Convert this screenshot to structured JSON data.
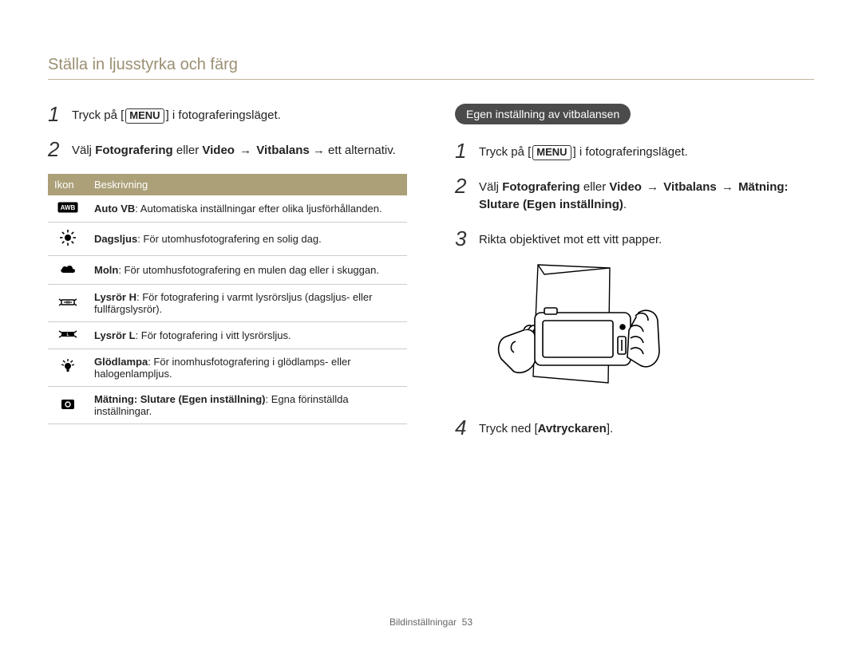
{
  "breadcrumb": "Ställa in ljusstyrka och färg",
  "left": {
    "step1_prefix": "Tryck på [",
    "step1_btn": "MENU",
    "step1_suffix": "] i fotograferingsläget.",
    "step2_a": "Välj ",
    "step2_b": "Fotografering",
    "step2_c": " eller ",
    "step2_d": "Video",
    "step2_e": " → ",
    "step2_f": "Vitbalans",
    "step2_g": " → ett alternativ."
  },
  "table": {
    "h1": "Ikon",
    "h2": "Beskrivning",
    "rows": [
      {
        "label": "Auto VB",
        "desc": ": Automatiska inställningar efter olika ljusförhållanden."
      },
      {
        "label": "Dagsljus",
        "desc": ": För utomhusfotografering en solig dag."
      },
      {
        "label": "Moln",
        "desc": ": För utomhusfotografering en mulen dag eller i skuggan."
      },
      {
        "label": "Lysrör H",
        "desc": ": För fotografering i varmt lysrörsljus (dagsljus- eller fullfärgslysrör)."
      },
      {
        "label": "Lysrör L",
        "desc": ": För fotografering i vitt lysrörsljus."
      },
      {
        "label": "Glödlampa",
        "desc": ": För inomhusfotografering i glödlamps- eller halogenlampljus."
      },
      {
        "label": "Mätning: Slutare (Egen inställning)",
        "desc": ": Egna förinställda inställningar."
      }
    ]
  },
  "right": {
    "pill": "Egen inställning av vitbalansen",
    "step1_prefix": "Tryck på [",
    "step1_btn": "MENU",
    "step1_suffix": "] i fotograferingsläget.",
    "step2_a": "Välj ",
    "step2_b": "Fotografering",
    "step2_c": " eller ",
    "step2_d": "Video",
    "step2_e": " → ",
    "step2_f": "Vitbalans",
    "step2_g": " → ",
    "step2_h": "Mätning: Slutare (Egen inställning)",
    "step2_i": ".",
    "step3": "Rikta objektivet mot ett vitt papper.",
    "step4_a": "Tryck ned [",
    "step4_b": "Avtryckaren",
    "step4_c": "]."
  },
  "footer_label": "Bildinställningar",
  "footer_page": "53"
}
